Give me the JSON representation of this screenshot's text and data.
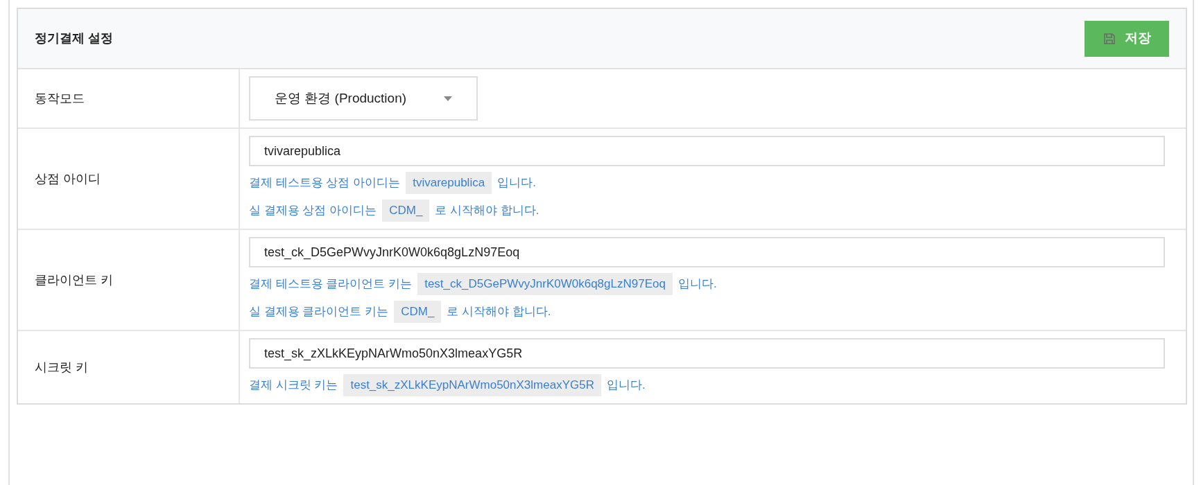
{
  "panel": {
    "title": "정기결제 설정",
    "save_button": "저장"
  },
  "rows": [
    {
      "kind": "select",
      "label": "동작모드",
      "value": "운영 환경 (Production)",
      "help": []
    },
    {
      "kind": "input",
      "label": "상점 아이디",
      "value": "tvivarepublica",
      "help": [
        {
          "before": "결제 테스트용 상점 아이디는",
          "code": "tvivarepublica",
          "after": "입니다."
        },
        {
          "before": "실 결제용 상점 아이디는",
          "code": "CDM_",
          "after": "로 시작해야 합니다."
        }
      ]
    },
    {
      "kind": "input",
      "label": "클라이언트 키",
      "value": "test_ck_D5GePWvyJnrK0W0k6q8gLzN97Eoq",
      "help": [
        {
          "before": "결제 테스트용 클라이언트 키는",
          "code": "test_ck_D5GePWvyJnrK0W0k6q8gLzN97Eoq",
          "after": "입니다."
        },
        {
          "before": "실 결제용 클라이언트 키는",
          "code": "CDM_",
          "after": "로 시작해야 합니다."
        }
      ]
    },
    {
      "kind": "input",
      "label": "시크릿 키",
      "value": "test_sk_zXLkKEypNArWmo50nX3lmeaxYG5R",
      "help": [
        {
          "before": "결제 시크릿 키는",
          "code": "test_sk_zXLkKEypNArWmo50nX3lmeaxYG5R",
          "after": "입니다."
        }
      ]
    }
  ]
}
